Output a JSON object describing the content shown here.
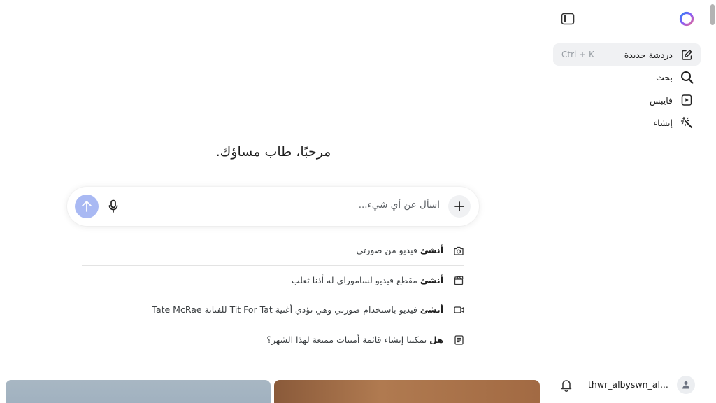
{
  "sidebar": {
    "toggle_icon": "sidebar-panel-icon",
    "logo_icon": "copilot-ring-logo",
    "items": [
      {
        "label": "دردشة جديدة",
        "icon": "edit-icon",
        "shortcut": "Ctrl + K",
        "active": true
      },
      {
        "label": "بحث",
        "icon": "search-icon"
      },
      {
        "label": "فايبس",
        "icon": "play-box-icon"
      },
      {
        "label": "إنشاء",
        "icon": "magic-wand-icon"
      }
    ],
    "user": {
      "name": "thwr_albyswn_al...",
      "bell_icon": "bell-icon",
      "avatar_icon": "person-icon"
    }
  },
  "main": {
    "welcome": "مرحبًا، طاب مساؤك.",
    "input": {
      "placeholder": "اسأل عن أي شيء..."
    },
    "suggestions": [
      {
        "icon": "camera-icon",
        "bold": "أنشئ",
        "text": " فيديو من صورتي"
      },
      {
        "icon": "clapperboard-icon",
        "bold": "أنشئ",
        "text": " مقطع فيديو لساموراي له أذنا ثعلب"
      },
      {
        "icon": "video-camera-icon",
        "bold": "أنشئ",
        "text": " فيديو باستخدام صورتي وهي تؤدي أغنية Tit For Tat للفنانة Tate McRae"
      },
      {
        "icon": "document-icon",
        "bold": "هل",
        "text": " يمكننا إنشاء قائمة أمنيات ممتعة لهذا الشهر؟"
      }
    ]
  },
  "colors": {
    "send_button": "#a9b9f3",
    "active_item_bg": "#f0f1f3"
  }
}
